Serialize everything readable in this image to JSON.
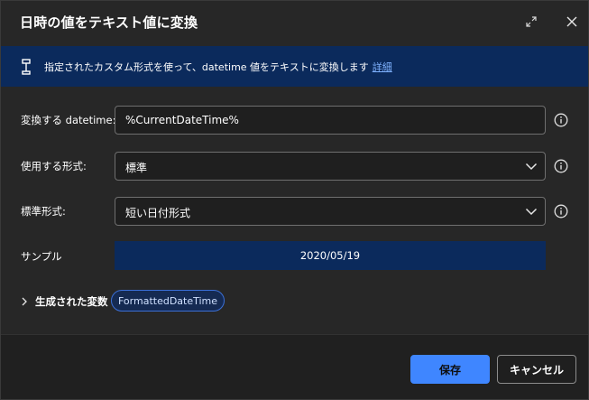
{
  "dialog": {
    "title": "日時の値をテキスト値に変換"
  },
  "info": {
    "text": "指定されたカスタム形式を使って、datetime 値をテキストに変換します",
    "link": "詳細"
  },
  "fields": {
    "datetime": {
      "label": "変換する datetime:",
      "value": "%CurrentDateTime%"
    },
    "format_kind": {
      "label": "使用する形式:",
      "value": "標準"
    },
    "standard_format": {
      "label": "標準形式:",
      "value": "短い日付形式"
    }
  },
  "sample": {
    "label": "サンプル",
    "value": "2020/05/19"
  },
  "vars": {
    "label": "生成された変数",
    "pill": "FormattedDateTime"
  },
  "buttons": {
    "save": "保存",
    "cancel": "キャンセル"
  },
  "colors": {
    "accent": "#3f86ff",
    "info_bar": "#0b2a5c",
    "dialog_bg": "#272727"
  },
  "icons": {
    "expand": "expand-icon",
    "close": "close-icon",
    "info": "text-cursor-icon",
    "help": "info-circle-icon",
    "chevron": "chevron-down-icon"
  }
}
